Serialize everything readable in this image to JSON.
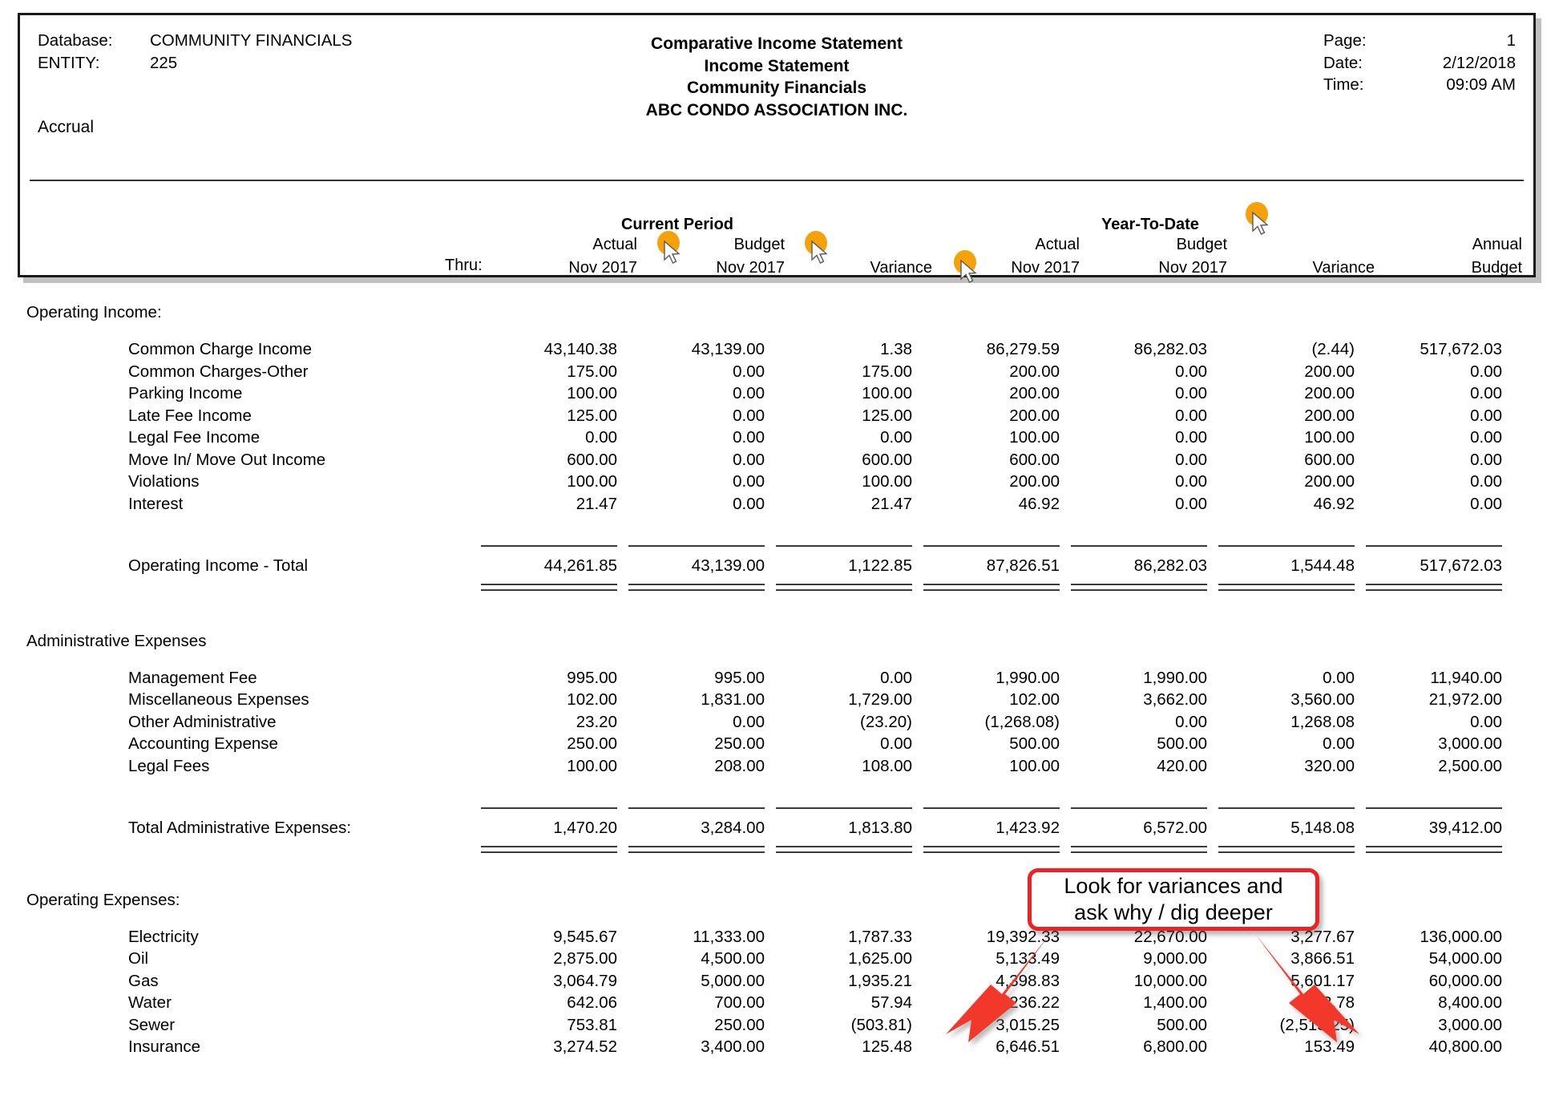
{
  "header": {
    "database_label": "Database:",
    "database_value": "COMMUNITY FINANCIALS",
    "entity_label": "ENTITY:",
    "entity_value": "225",
    "basis": "Accrual",
    "title_line1": "Comparative Income Statement",
    "title_line2": "Income Statement",
    "title_line3": "Community Financials",
    "title_line4": "ABC CONDO ASSOCIATION INC.",
    "page_label": "Page:",
    "page_value": "1",
    "date_label": "Date:",
    "date_value": "2/12/2018",
    "time_label": "Time:",
    "time_value": "09:09 AM"
  },
  "columns": {
    "group_current": "Current Period",
    "group_ytd": "Year-To-Date",
    "thru_label": "Thru:",
    "cp_actual_l1": "Actual",
    "cp_actual_l2": "Nov 2017",
    "cp_budget_l1": "Budget",
    "cp_budget_l2": "Nov 2017",
    "cp_variance_l2": "Variance",
    "ytd_actual_l1": "Actual",
    "ytd_actual_l2": "Nov 2017",
    "ytd_budget_l1": "Budget",
    "ytd_budget_l2": "Nov 2017",
    "ytd_variance_l2": "Variance",
    "annual_l1": "Annual",
    "annual_l2": "Budget"
  },
  "sections": {
    "operating_income": {
      "title": "Operating Income:",
      "rows": [
        {
          "label": "Common Charge Income",
          "cp_actual": "43,140.38",
          "cp_budget": "43,139.00",
          "cp_var": "1.38",
          "ytd_actual": "86,279.59",
          "ytd_budget": "86,282.03",
          "ytd_var": "(2.44)",
          "annual": "517,672.03"
        },
        {
          "label": "Common Charges-Other",
          "cp_actual": "175.00",
          "cp_budget": "0.00",
          "cp_var": "175.00",
          "ytd_actual": "200.00",
          "ytd_budget": "0.00",
          "ytd_var": "200.00",
          "annual": "0.00"
        },
        {
          "label": "Parking Income",
          "cp_actual": "100.00",
          "cp_budget": "0.00",
          "cp_var": "100.00",
          "ytd_actual": "200.00",
          "ytd_budget": "0.00",
          "ytd_var": "200.00",
          "annual": "0.00"
        },
        {
          "label": "Late Fee Income",
          "cp_actual": "125.00",
          "cp_budget": "0.00",
          "cp_var": "125.00",
          "ytd_actual": "200.00",
          "ytd_budget": "0.00",
          "ytd_var": "200.00",
          "annual": "0.00"
        },
        {
          "label": "Legal Fee Income",
          "cp_actual": "0.00",
          "cp_budget": "0.00",
          "cp_var": "0.00",
          "ytd_actual": "100.00",
          "ytd_budget": "0.00",
          "ytd_var": "100.00",
          "annual": "0.00"
        },
        {
          "label": "Move In/ Move Out Income",
          "cp_actual": "600.00",
          "cp_budget": "0.00",
          "cp_var": "600.00",
          "ytd_actual": "600.00",
          "ytd_budget": "0.00",
          "ytd_var": "600.00",
          "annual": "0.00"
        },
        {
          "label": "Violations",
          "cp_actual": "100.00",
          "cp_budget": "0.00",
          "cp_var": "100.00",
          "ytd_actual": "200.00",
          "ytd_budget": "0.00",
          "ytd_var": "200.00",
          "annual": "0.00"
        },
        {
          "label": "Interest",
          "cp_actual": "21.47",
          "cp_budget": "0.00",
          "cp_var": "21.47",
          "ytd_actual": "46.92",
          "ytd_budget": "0.00",
          "ytd_var": "46.92",
          "annual": "0.00"
        }
      ],
      "total": {
        "label": "Operating Income - Total",
        "cp_actual": "44,261.85",
        "cp_budget": "43,139.00",
        "cp_var": "1,122.85",
        "ytd_actual": "87,826.51",
        "ytd_budget": "86,282.03",
        "ytd_var": "1,544.48",
        "annual": "517,672.03"
      }
    },
    "administrative_expenses": {
      "title": "Administrative Expenses",
      "rows": [
        {
          "label": "Management Fee",
          "cp_actual": "995.00",
          "cp_budget": "995.00",
          "cp_var": "0.00",
          "ytd_actual": "1,990.00",
          "ytd_budget": "1,990.00",
          "ytd_var": "0.00",
          "annual": "11,940.00"
        },
        {
          "label": "Miscellaneous Expenses",
          "cp_actual": "102.00",
          "cp_budget": "1,831.00",
          "cp_var": "1,729.00",
          "ytd_actual": "102.00",
          "ytd_budget": "3,662.00",
          "ytd_var": "3,560.00",
          "annual": "21,972.00"
        },
        {
          "label": "Other Administrative",
          "cp_actual": "23.20",
          "cp_budget": "0.00",
          "cp_var": "(23.20)",
          "ytd_actual": "(1,268.08)",
          "ytd_budget": "0.00",
          "ytd_var": "1,268.08",
          "annual": "0.00"
        },
        {
          "label": "Accounting Expense",
          "cp_actual": "250.00",
          "cp_budget": "250.00",
          "cp_var": "0.00",
          "ytd_actual": "500.00",
          "ytd_budget": "500.00",
          "ytd_var": "0.00",
          "annual": "3,000.00"
        },
        {
          "label": "Legal Fees",
          "cp_actual": "100.00",
          "cp_budget": "208.00",
          "cp_var": "108.00",
          "ytd_actual": "100.00",
          "ytd_budget": "420.00",
          "ytd_var": "320.00",
          "annual": "2,500.00"
        }
      ],
      "total": {
        "label": "Total Administrative Expenses:",
        "cp_actual": "1,470.20",
        "cp_budget": "3,284.00",
        "cp_var": "1,813.80",
        "ytd_actual": "1,423.92",
        "ytd_budget": "6,572.00",
        "ytd_var": "5,148.08",
        "annual": "39,412.00"
      }
    },
    "operating_expenses": {
      "title": "Operating  Expenses:",
      "rows": [
        {
          "label": "Electricity",
          "cp_actual": "9,545.67",
          "cp_budget": "11,333.00",
          "cp_var": "1,787.33",
          "ytd_actual": "19,392.33",
          "ytd_budget": "22,670.00",
          "ytd_var": "3,277.67",
          "annual": "136,000.00"
        },
        {
          "label": "Oil",
          "cp_actual": "2,875.00",
          "cp_budget": "4,500.00",
          "cp_var": "1,625.00",
          "ytd_actual": "5,133.49",
          "ytd_budget": "9,000.00",
          "ytd_var": "3,866.51",
          "annual": "54,000.00"
        },
        {
          "label": "Gas",
          "cp_actual": "3,064.79",
          "cp_budget": "5,000.00",
          "cp_var": "1,935.21",
          "ytd_actual": "4,398.83",
          "ytd_budget": "10,000.00",
          "ytd_var": "5,601.17",
          "annual": "60,000.00"
        },
        {
          "label": "Water",
          "cp_actual": "642.06",
          "cp_budget": "700.00",
          "cp_var": "57.94",
          "ytd_actual": "1,236.22",
          "ytd_budget": "1,400.00",
          "ytd_var": "163.78",
          "annual": "8,400.00"
        },
        {
          "label": "Sewer",
          "cp_actual": "753.81",
          "cp_budget": "250.00",
          "cp_var": "(503.81)",
          "ytd_actual": "3,015.25",
          "ytd_budget": "500.00",
          "ytd_var": "(2,515.25)",
          "annual": "3,000.00"
        },
        {
          "label": "Insurance",
          "cp_actual": "3,274.52",
          "cp_budget": "3,400.00",
          "cp_var": "125.48",
          "ytd_actual": "6,646.51",
          "ytd_budget": "6,800.00",
          "ytd_var": "153.49",
          "annual": "40,800.00"
        }
      ]
    }
  },
  "annotation": {
    "line1": "Look for variances and",
    "line2": "ask why / dig deeper",
    "border_color": "#ee2222",
    "arrow_color": "#f2372c"
  },
  "markers": {
    "color": "#f5a20a",
    "items": [
      {
        "name": "cp-actual-marker"
      },
      {
        "name": "cp-budget-marker"
      },
      {
        "name": "cp-variance-marker"
      },
      {
        "name": "ytd-group-marker"
      }
    ]
  }
}
